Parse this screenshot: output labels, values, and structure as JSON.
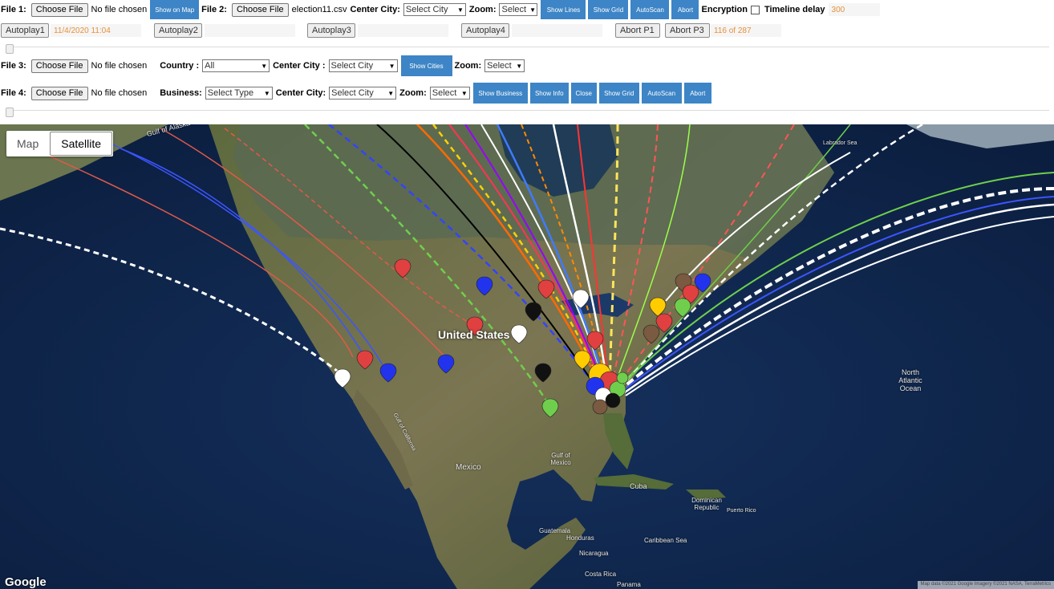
{
  "row1": {
    "file1_label": "File 1:",
    "file1_button": "Choose File",
    "file1_status": "No file chosen",
    "show_on_map": "Show on Map",
    "file2_label": "File 2:",
    "file2_button": "Choose File",
    "file2_status": "election11.csv",
    "center_city_label": "Center City:",
    "center_city_value": "Select City",
    "zoom_label": "Zoom:",
    "zoom_value": "Select",
    "show_lines": "Show Lines",
    "show_grid": "Show Grid",
    "autoscan": "AutoScan",
    "abort": "Abort",
    "encryption_label": "Encryption",
    "timeline_delay_label": "Timeline delay",
    "timeline_delay_value": "300"
  },
  "row2": {
    "autoplay1": "Autoplay1",
    "autoplay1_value": "11/4/2020 11:04",
    "autoplay2": "Autoplay2",
    "autoplay3": "Autoplay3",
    "autoplay4": "Autoplay4",
    "abort_p1": "Abort P1",
    "abort_p3": "Abort P3",
    "progress": "116 of 287"
  },
  "row3": {
    "file3_label": "File 3:",
    "file3_button": "Choose File",
    "file3_status": "No file chosen",
    "country_label": "Country :",
    "country_value": "All",
    "center_city_label": "Center City :",
    "center_city_value": "Select City",
    "show_cities": "Show Cities",
    "zoom_label": "Zoom:",
    "zoom_value": "Select"
  },
  "row4": {
    "file4_label": "File 4:",
    "file4_button": "Choose File",
    "file4_status": "No file chosen",
    "business_label": "Business:",
    "business_value": "Select Type",
    "center_city_label": "Center City:",
    "center_city_value": "Select City",
    "zoom_label": "Zoom:",
    "zoom_value": "Select",
    "show_business": "Show Business",
    "show_info": "Show Info",
    "close": "Close",
    "show_grid": "Show Grid",
    "autoscan": "AutoScan",
    "abort": "Abort"
  },
  "map": {
    "type_map": "Map",
    "type_satellite": "Satellite",
    "labels": {
      "united_states": "United States",
      "mexico": "Mexico",
      "gulf_of_mexico": "Gulf of Mexico",
      "north_atlantic": "North Atlantic Ocean",
      "cuba": "Cuba",
      "dominican_republic": "Dominican Republic",
      "puerto_rico": "Puerto Rico",
      "caribbean_sea": "Caribbean Sea",
      "guatemala": "Guatemala",
      "honduras": "Honduras",
      "nicaragua": "Nicaragua",
      "costa_rica": "Costa Rica",
      "panama": "Panama",
      "gulf_of_alaska": "Gulf of Alaska",
      "gulf_of_california": "Gulf of California",
      "labrador_sea": "Labrador Sea"
    },
    "google": "Google",
    "attribution": "Map data ©2021 Google Imagery ©2021 NASA, TerraMetrics"
  },
  "colors": {
    "button_blue": "#3d85c6",
    "accent_orange": "#e69138"
  }
}
